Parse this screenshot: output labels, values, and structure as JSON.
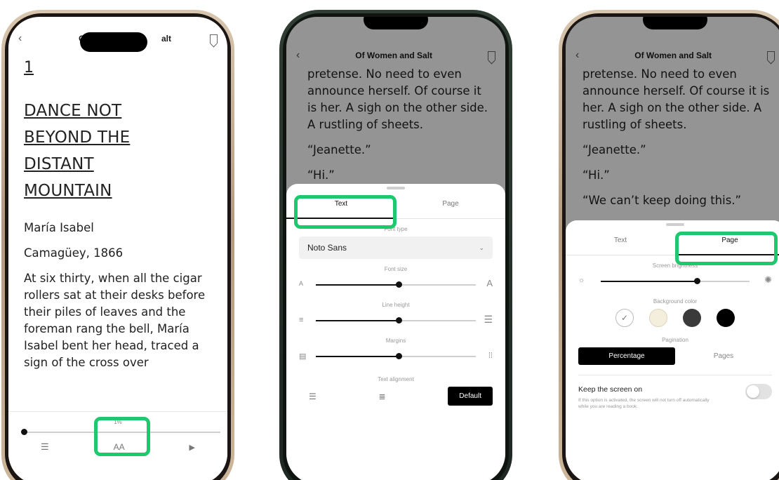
{
  "book_title": "Of Women and Salt",
  "book_title_partial_left": "Of",
  "book_title_partial_right": "alt",
  "phone1": {
    "chapter_number": "1",
    "chapter_title": [
      "DANCE NOT",
      "BEYOND THE",
      "DISTANT",
      "MOUNTAIN"
    ],
    "paragraphs": [
      "María Isabel",
      "Camagüey, 1866",
      "At six thirty, when all the cigar rollers sat at their desks before their piles of leaves and the foreman rang the bell, María Isabel bent her head, traced a sign of the cross over"
    ],
    "progress_label": "1%",
    "progress_fraction": 0.0,
    "font_button_label": "AA"
  },
  "phone2": {
    "reading_lines": [
      "pretense. No need to even announce herself. Of course it is her. A sigh on the other side. A rustling of sheets.",
      "“Jeanette.”",
      "“Hi.”"
    ],
    "tabs": [
      "Text",
      "Page"
    ],
    "active_tab": "Text",
    "font_type_label": "Font type",
    "font_type_value": "Noto Sans",
    "font_size_label": "Font size",
    "font_size_level": 0.52,
    "line_height_label": "Line height",
    "line_height_level": 0.52,
    "margins_label": "Margins",
    "margins_level": 0.52,
    "text_alignment_label": "Text alignment",
    "alignment_default_label": "Default"
  },
  "phone3": {
    "reading_lines": [
      "pretense. No need to even announce herself. Of course it is her. A sigh on the other side. A rustling of sheets.",
      "“Jeanette.”",
      "“Hi.”",
      "“We can’t keep doing this.”"
    ],
    "tabs": [
      "Text",
      "Page"
    ],
    "active_tab": "Page",
    "brightness_label": "Screen brightness",
    "brightness_level": 0.65,
    "background_color_label": "Background color",
    "background_colors": [
      "#ffffff",
      "#f4eedd",
      "#3a3a3a",
      "#000000"
    ],
    "pagination_label": "Pagination",
    "pagination_options": [
      "Percentage",
      "Pages"
    ],
    "pagination_selected": "Percentage",
    "keep_screen_on_label": "Keep the screen on",
    "keep_screen_on_desc": "If this option is activated, the screen will not turn off automatically while you are reading a book."
  },
  "highlight_color": "#1ec86e"
}
